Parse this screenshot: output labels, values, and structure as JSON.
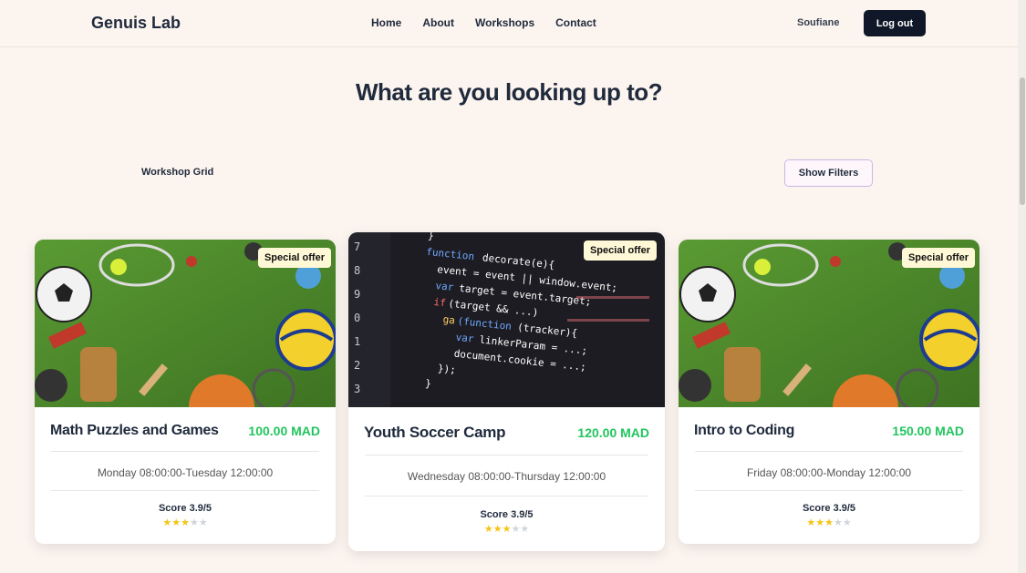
{
  "nav": {
    "logo": "Genuis Lab",
    "links": [
      "Home",
      "About",
      "Workshops",
      "Contact"
    ],
    "user": "Soufiane",
    "logout": "Log out"
  },
  "headline": "What are you looking up to?",
  "grid_label": "Workshop Grid",
  "filters_button": "Show Filters",
  "cards": [
    {
      "badge": "Special offer",
      "title": "Math Puzzles and Games",
      "price": "100.00 MAD",
      "dates": "Monday 08:00:00-Tuesday 12:00:00",
      "score": "Score 3.9/5",
      "rating": 3,
      "image": "sports-equipment-image"
    },
    {
      "badge": "Special offer",
      "title": "Youth Soccer Camp",
      "price": "120.00 MAD",
      "dates": "Wednesday 08:00:00-Thursday 12:00:00",
      "score": "Score 3.9/5",
      "rating": 3,
      "image": "code-editor-image"
    },
    {
      "badge": "Special offer",
      "title": "Intro to Coding",
      "price": "150.00 MAD",
      "dates": "Friday 08:00:00-Monday 12:00:00",
      "score": "Score 3.9/5",
      "rating": 3,
      "image": "sports-equipment-image"
    }
  ],
  "colors": {
    "price": "#22c55e",
    "logout_bg": "#0f1729",
    "page_bg": "#fcf4ef",
    "badge_bg": "#fff8d6"
  }
}
